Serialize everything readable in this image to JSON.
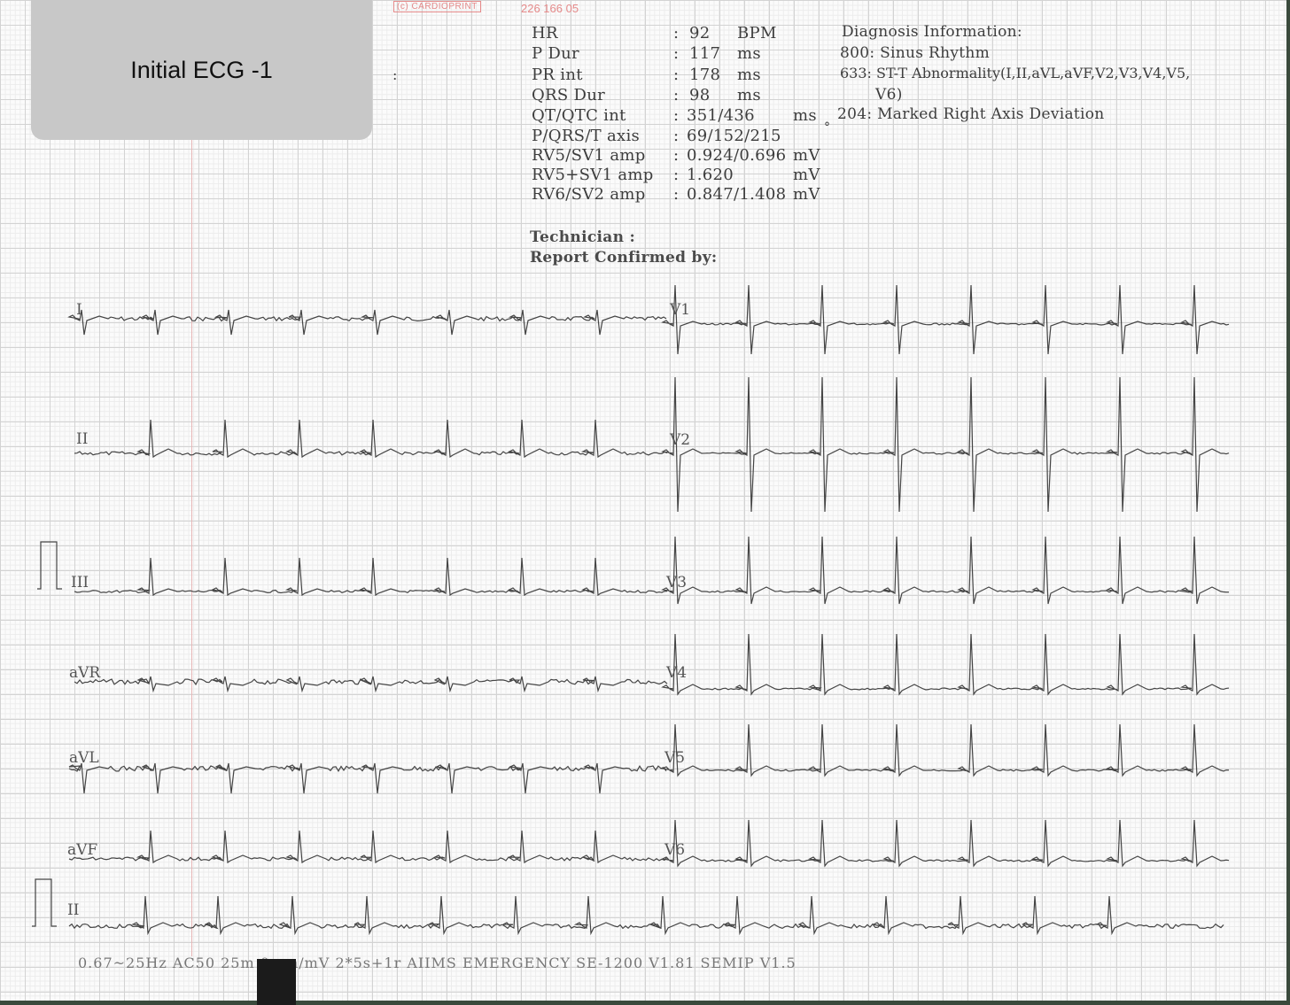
{
  "header": {
    "label": "Initial ECG -1",
    "brand": "(c) CARDIOPRINT",
    "serial": "226 166 05"
  },
  "measurements": [
    {
      "name": "HR",
      "value": "92",
      "unit": "BPM"
    },
    {
      "name": "P Dur",
      "value": "117",
      "unit": "ms"
    },
    {
      "name": "PR int",
      "value": "178",
      "unit": "ms"
    },
    {
      "name": "QRS Dur",
      "value": "98",
      "unit": "ms"
    },
    {
      "name": "QT/QTC int",
      "value": "351/436",
      "unit": "ms"
    },
    {
      "name": "P/QRS/T axis",
      "value": "69/152/215",
      "unit": "°"
    },
    {
      "name": "RV5/SV1 amp",
      "value": "0.924/0.696",
      "unit": "mV"
    },
    {
      "name": "RV5+SV1 amp",
      "value": "1.620",
      "unit": "mV"
    },
    {
      "name": "RV6/SV2 amp",
      "value": "0.847/1.408",
      "unit": "mV"
    }
  ],
  "diagnosis": {
    "title": "Diagnosis Information:",
    "lines": [
      "800: Sinus Rhythm",
      "633: ST-T Abnormality(I,II,aVL,aVF,V2,V3,V4,V5,",
      "V6)",
      "204: Marked Right Axis Deviation"
    ]
  },
  "technician": "Technician :",
  "confirmed": "Report Confirmed by:",
  "leads": {
    "left": [
      "I",
      "II",
      "III",
      "aVR",
      "aVL",
      "aVF",
      "II"
    ],
    "right": [
      "V1",
      "V2",
      "V3",
      "V4",
      "V5",
      "V6"
    ]
  },
  "footer": "0.67~25Hz AC50 25m        0mm/mV 2*5s+1r AIIMS EMERGENCY   SE-1200  V1.81   SEMIP V1.5"
}
